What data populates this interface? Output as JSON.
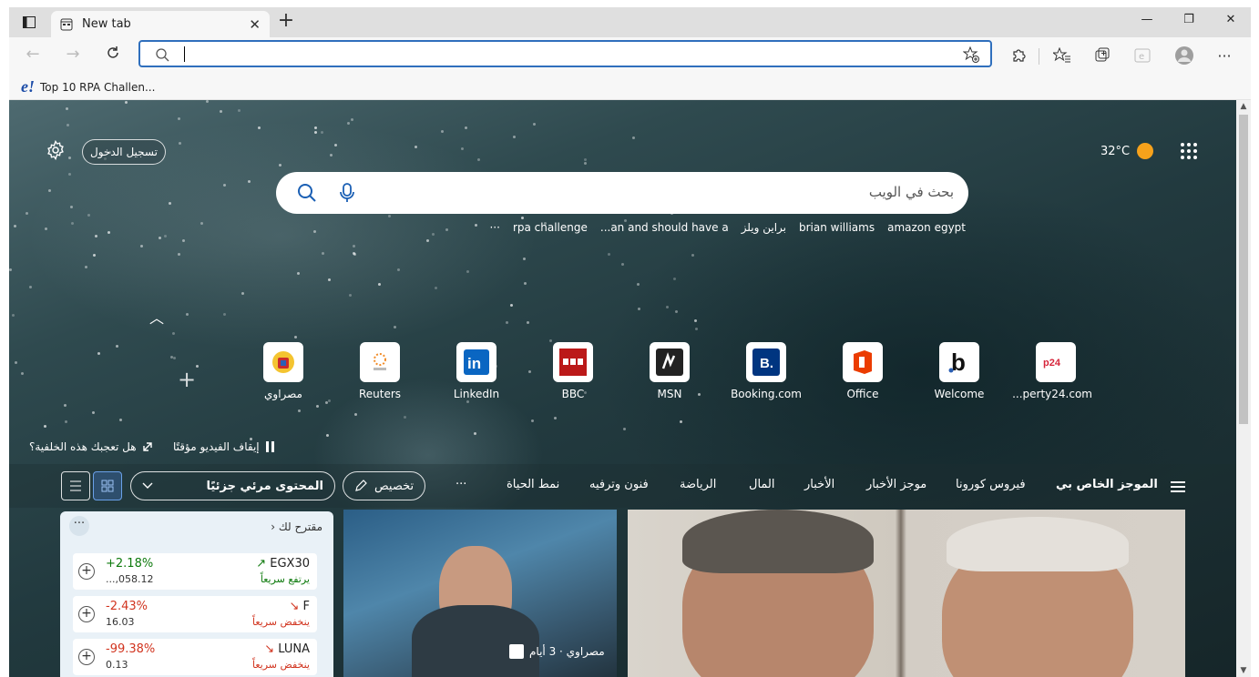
{
  "tab": {
    "title": "New tab"
  },
  "window": {
    "minimize": "—",
    "restore": "❐",
    "close": "✕"
  },
  "favorites": [
    {
      "icon": "e!",
      "label": "Top 10 RPA Challen..."
    }
  ],
  "page": {
    "signin": "تسجيل الدخول",
    "weather": "32°C",
    "search_placeholder": "بحث في الويب",
    "trending": [
      "amazon egypt",
      "brian williams",
      "براين ويلز",
      "an and should have a...",
      "rpa challenge",
      "···"
    ],
    "tiles": [
      {
        "label": "مصراوي"
      },
      {
        "label": "Reuters"
      },
      {
        "label": "LinkedIn"
      },
      {
        "label": "BBC"
      },
      {
        "label": "MSN"
      },
      {
        "label": "Booking.com"
      },
      {
        "label": "Office"
      },
      {
        "label": "Welcome"
      },
      {
        "label": "perty24.com..."
      }
    ],
    "pause_video": "إيقاف الفيديو مؤقتًا",
    "like_background": "هل تعجبك هذه الخلفية؟"
  },
  "newsbar": {
    "items": [
      "الموجز الخاص بي",
      "فيروس كورونا",
      "موجز الأخبار",
      "الأخبار",
      "المال",
      "الرياضة",
      "فنون وترفيه",
      "نمط الحياة",
      "···"
    ],
    "personalize": "تخصيص",
    "content_mode": "المحتوى مرئي جزئيًا"
  },
  "markets": {
    "header": "مقترح لك",
    "more": "···",
    "rows": [
      {
        "name": "EGX30",
        "pct": "+2.18%",
        "value": "...,058.12",
        "note": "يرتفع سريعاً",
        "trend": "up"
      },
      {
        "name": "F",
        "pct": "-2.43%",
        "value": "16.03",
        "note": "ينخفض سريعاً",
        "trend": "down"
      },
      {
        "name": "LUNA",
        "pct": "-99.38%",
        "value": "0.13",
        "note": "ينخفض سريعاً",
        "trend": "down"
      }
    ]
  },
  "cards": [
    {
      "source": "مصراوي · 3 أيام"
    }
  ]
}
